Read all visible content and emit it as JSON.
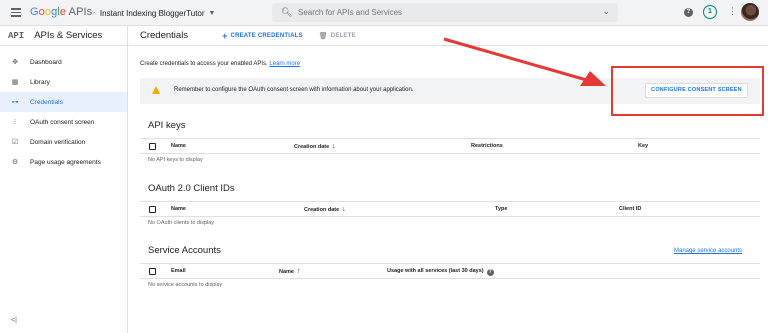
{
  "topbar": {
    "logo_google": "Google",
    "logo_apis": "APIs",
    "project_name": "Instant Indexing BloggerTutor",
    "search_placeholder": "Search for APIs and Services",
    "notification_count": "1"
  },
  "sidebar": {
    "badge": "API",
    "title": "APIs & Services",
    "items": [
      {
        "label": "Dashboard",
        "icon": "dashboard-icon",
        "glyph": "✥"
      },
      {
        "label": "Library",
        "icon": "library-icon",
        "glyph": "▦"
      },
      {
        "label": "Credentials",
        "icon": "key-icon",
        "glyph": "⊶",
        "active": true
      },
      {
        "label": "OAuth consent screen",
        "icon": "consent-icon",
        "glyph": "⁝"
      },
      {
        "label": "Domain verification",
        "icon": "verify-icon",
        "glyph": "☑"
      },
      {
        "label": "Page usage agreements",
        "icon": "settings-icon",
        "glyph": "⚙"
      }
    ],
    "collapse_label": "<|"
  },
  "header": {
    "title": "Credentials",
    "create_label": "CREATE CREDENTIALS",
    "delete_label": "DELETE"
  },
  "intro": {
    "text": "Create credentials to access your enabled APIs.",
    "link": "Learn more"
  },
  "banner": {
    "text": "Remember to configure the OAuth consent screen with information about your application.",
    "button": "CONFIGURE CONSENT SCREEN"
  },
  "api_keys": {
    "title": "API keys",
    "columns": [
      "Name",
      "Creation date",
      "Restrictions",
      "Key"
    ],
    "empty": "No API keys to display"
  },
  "oauth": {
    "title": "OAuth 2.0 Client IDs",
    "columns": [
      "Name",
      "Creation date",
      "Type",
      "Client ID"
    ],
    "empty": "No OAuth clients to display"
  },
  "service_accounts": {
    "title": "Service Accounts",
    "manage_link": "Manage service accounts",
    "columns": [
      "Email",
      "Name",
      "Usage with all services (last 30 days)"
    ],
    "empty": "No service accounts to display"
  },
  "colors": {
    "accent": "#1a73e8",
    "annotation_red": "#e53935",
    "warning": "#f9ab00"
  }
}
